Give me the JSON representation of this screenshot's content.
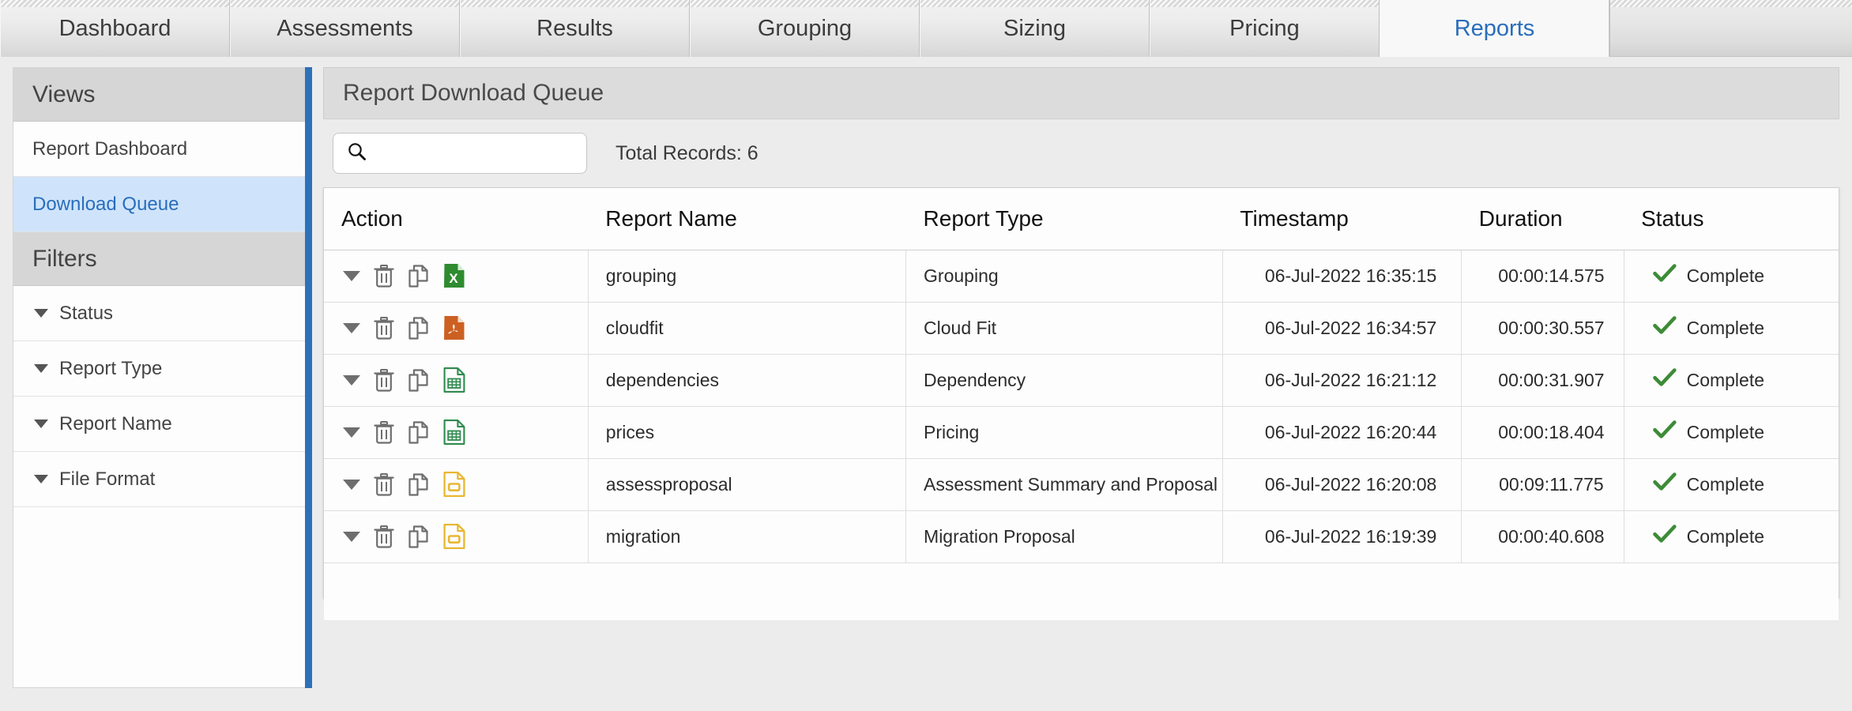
{
  "tabs": [
    {
      "label": "Dashboard",
      "active": false
    },
    {
      "label": "Assessments",
      "active": false
    },
    {
      "label": "Results",
      "active": false
    },
    {
      "label": "Grouping",
      "active": false
    },
    {
      "label": "Sizing",
      "active": false
    },
    {
      "label": "Pricing",
      "active": false
    },
    {
      "label": "Reports",
      "active": true
    }
  ],
  "sidebar": {
    "views_header": "Views",
    "views": [
      {
        "label": "Report Dashboard",
        "selected": false
      },
      {
        "label": "Download Queue",
        "selected": true
      }
    ],
    "filters_header": "Filters",
    "filters": [
      {
        "label": "Status"
      },
      {
        "label": "Report Type"
      },
      {
        "label": "Report Name"
      },
      {
        "label": "File Format"
      }
    ]
  },
  "main": {
    "panel_title": "Report Download Queue",
    "search": {
      "value": "",
      "placeholder": ""
    },
    "total_records": "Total Records: 6",
    "table": {
      "columns": [
        "Action",
        "Report Name",
        "Report Type",
        "Timestamp",
        "Duration",
        "Status"
      ],
      "rows": [
        {
          "report_name": "grouping",
          "report_type": "Grouping",
          "timestamp": "06-Jul-2022 16:35:15",
          "duration": "00:00:14.575",
          "status": "Complete",
          "file_format": "excel"
        },
        {
          "report_name": "cloudfit",
          "report_type": "Cloud Fit",
          "timestamp": "06-Jul-2022 16:34:57",
          "duration": "00:00:30.557",
          "status": "Complete",
          "file_format": "pdf"
        },
        {
          "report_name": "dependencies",
          "report_type": "Dependency",
          "timestamp": "06-Jul-2022 16:21:12",
          "duration": "00:00:31.907",
          "status": "Complete",
          "file_format": "csv"
        },
        {
          "report_name": "prices",
          "report_type": "Pricing",
          "timestamp": "06-Jul-2022 16:20:44",
          "duration": "00:00:18.404",
          "status": "Complete",
          "file_format": "csv"
        },
        {
          "report_name": "assessproposal",
          "report_type": "Assessment Summary and Proposal",
          "timestamp": "06-Jul-2022 16:20:08",
          "duration": "00:09:11.775",
          "status": "Complete",
          "file_format": "ppt"
        },
        {
          "report_name": "migration",
          "report_type": "Migration Proposal",
          "timestamp": "06-Jul-2022 16:19:39",
          "duration": "00:00:40.608",
          "status": "Complete",
          "file_format": "ppt"
        }
      ]
    }
  },
  "colors": {
    "accent_blue": "#2a6ebb",
    "rail_blue": "#2d72b8",
    "selected_row": "#cfe4fb",
    "status_green": "#3d8b37",
    "excel_green": "#2f8b2f",
    "pdf_orange": "#cc6022",
    "csv_green": "#2f8b4e",
    "ppt_yellow": "#e8b733",
    "icon_grey": "#6e6e6e"
  }
}
